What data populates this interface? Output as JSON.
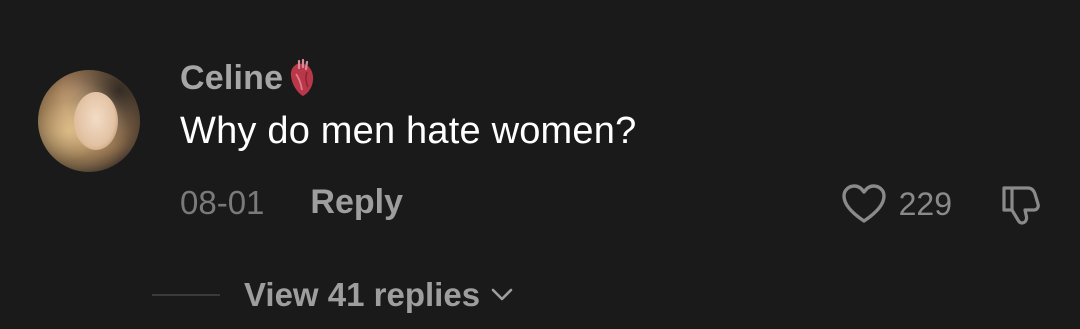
{
  "comment": {
    "username": "Celine",
    "username_emoji": "anatomical-heart",
    "text": "Why do men hate women?",
    "date": "08-01",
    "reply_label": "Reply",
    "like_count": "229",
    "view_replies_label": "View 41 replies"
  },
  "icons": {
    "like": "heart-outline-icon",
    "dislike": "thumbs-down-icon",
    "expand": "chevron-down-icon"
  },
  "colors": {
    "background": "#1a1a1a",
    "username": "#a6a6a6",
    "body": "#ffffff",
    "muted": "#7a7a7a",
    "emoji_heart": "#b8384a"
  }
}
